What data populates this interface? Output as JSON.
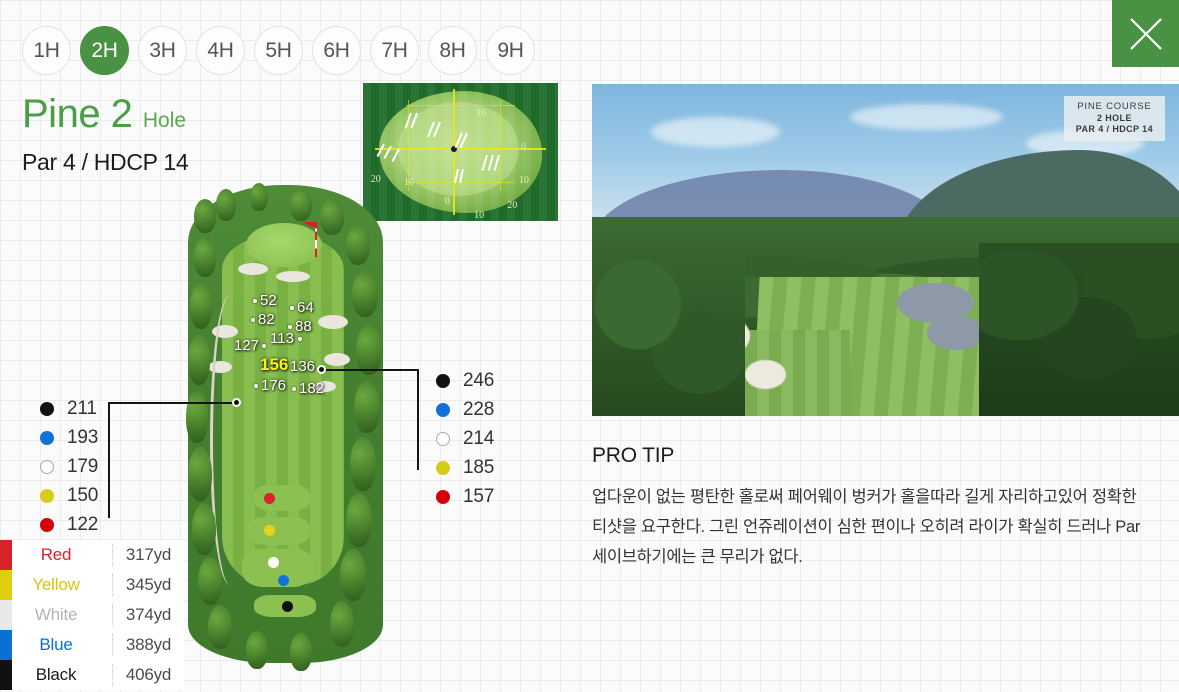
{
  "close_button": {
    "icon": "close-icon",
    "label": "Close"
  },
  "hole_tabs": [
    {
      "label": "1H",
      "active": false
    },
    {
      "label": "2H",
      "active": true
    },
    {
      "label": "3H",
      "active": false
    },
    {
      "label": "4H",
      "active": false
    },
    {
      "label": "5H",
      "active": false
    },
    {
      "label": "6H",
      "active": false
    },
    {
      "label": "7H",
      "active": false
    },
    {
      "label": "8H",
      "active": false
    },
    {
      "label": "9H",
      "active": false
    }
  ],
  "header": {
    "course_name": "Pine 2",
    "hole_word": "Hole",
    "par_hdcp": "Par 4 / HDCP 14",
    "title_color": "#4a9e46"
  },
  "green_map": {
    "name": "green-contour-map",
    "labels": [
      "10",
      "0",
      "10",
      "20",
      "10",
      "0",
      "10",
      "20"
    ]
  },
  "course_map": {
    "distances": [
      {
        "value": "52",
        "highlight": false
      },
      {
        "value": "82",
        "highlight": false
      },
      {
        "value": "64",
        "highlight": false
      },
      {
        "value": "88",
        "highlight": false
      },
      {
        "value": "127",
        "highlight": false
      },
      {
        "value": "113",
        "highlight": false
      },
      {
        "value": "156",
        "highlight": true
      },
      {
        "value": "136",
        "highlight": false
      },
      {
        "value": "176",
        "highlight": false
      },
      {
        "value": "182",
        "highlight": false
      }
    ],
    "tee_markers": [
      "#d8232a",
      "#e8d41a",
      "#ffffff",
      "#1271d8",
      "#111111"
    ]
  },
  "legend_left": {
    "name": "distance-legend-near",
    "rows": [
      {
        "value": "211",
        "color": "#111111"
      },
      {
        "value": "193",
        "color": "#1271d8"
      },
      {
        "value": "179",
        "color": "#ffffff"
      },
      {
        "value": "150",
        "color": "#d8cb18"
      },
      {
        "value": "122",
        "color": "#d4000a"
      }
    ]
  },
  "legend_right": {
    "name": "distance-legend-far",
    "rows": [
      {
        "value": "246",
        "color": "#111111"
      },
      {
        "value": "228",
        "color": "#1271d8"
      },
      {
        "value": "214",
        "color": "#ffffff"
      },
      {
        "value": "185",
        "color": "#d8cb18"
      },
      {
        "value": "157",
        "color": "#d4000a"
      }
    ]
  },
  "tee_table": {
    "rows": [
      {
        "name": "Red",
        "distance": "317yd",
        "color": "#d8232a"
      },
      {
        "name": "Yellow",
        "distance": "345yd",
        "color": "#e0ce10"
      },
      {
        "name": "White",
        "distance": "374yd",
        "color": "#e8e8e8"
      },
      {
        "name": "Blue",
        "distance": "388yd",
        "color": "#0b6fd4"
      },
      {
        "name": "Black",
        "distance": "406yd",
        "color": "#111111"
      }
    ]
  },
  "photo": {
    "name": "hole-aerial-photo",
    "plate_line1": "PINE COURSE",
    "plate_line2": "2 HOLE",
    "plate_line3": "PAR 4 / HDCP 14"
  },
  "protip": {
    "title": "PRO TIP",
    "body": "업다운이 없는 평탄한 홀로써 페어웨이 벙커가 홀을따라 길게 자리하고있어 정확한 티샷을 요구한다. 그린 언쥬레이션이 심한 편이나 오히려 라이가 확실히 드러나 Par세이브하기에는 큰 무리가 없다."
  }
}
